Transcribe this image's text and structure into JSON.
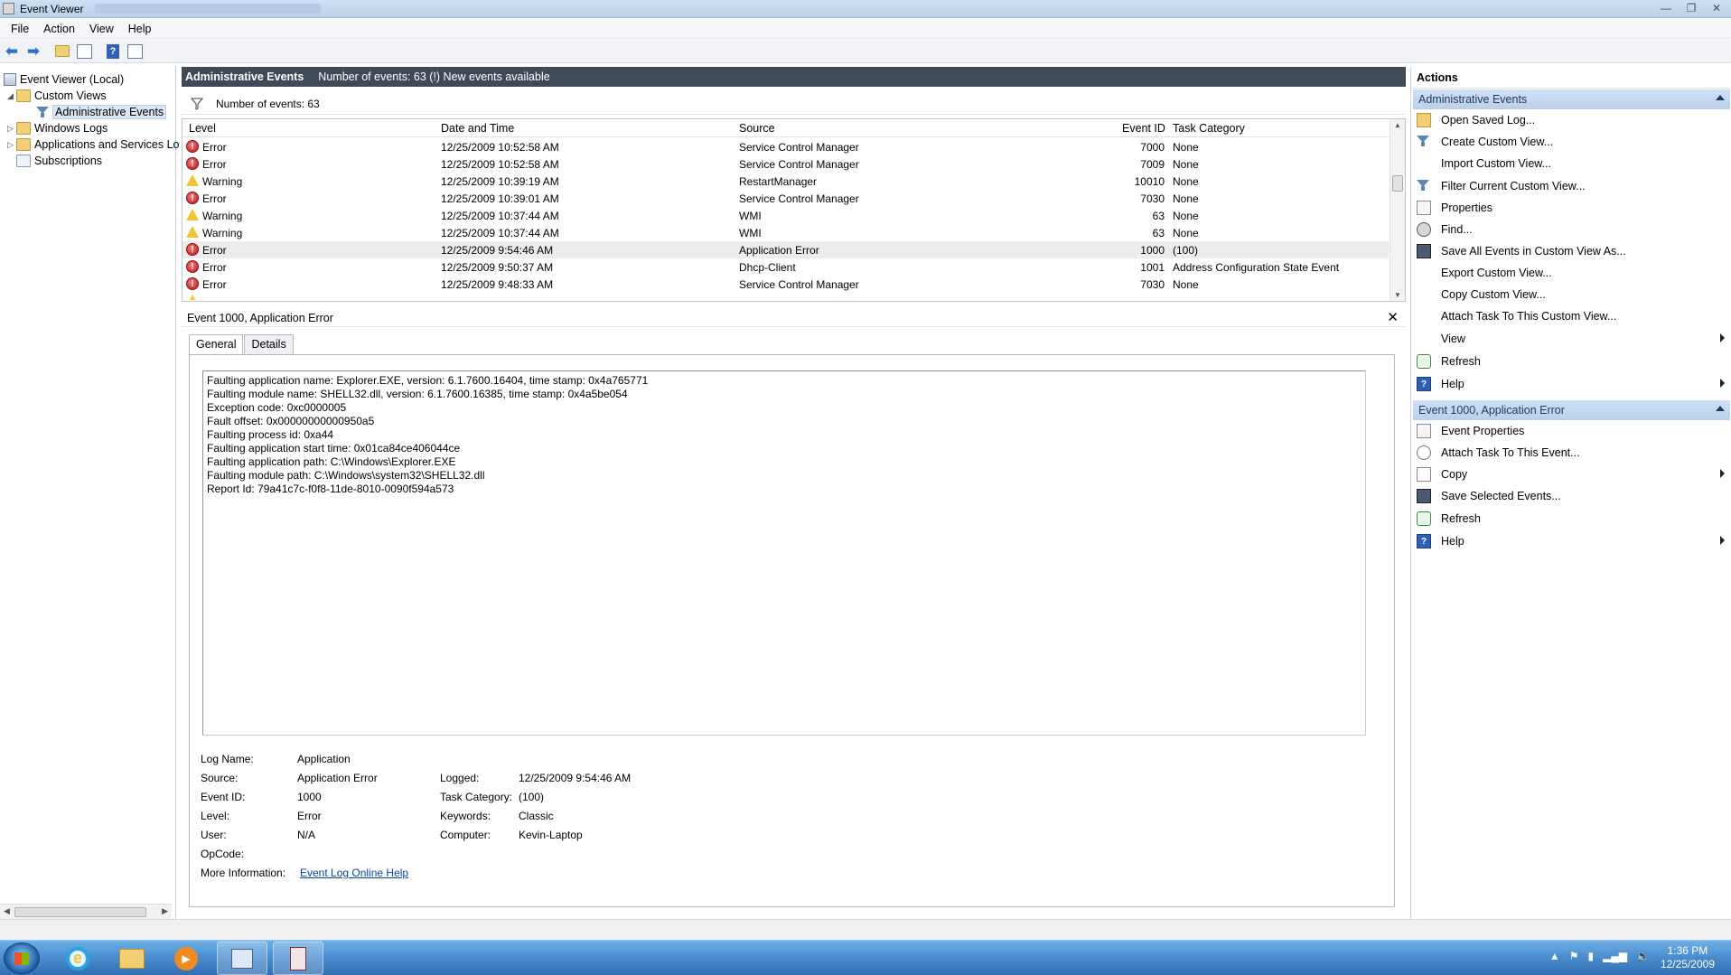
{
  "window": {
    "title": "Event Viewer",
    "controls": [
      "—",
      "❐",
      "✕"
    ]
  },
  "menu": [
    "File",
    "Action",
    "View",
    "Help"
  ],
  "tree": {
    "root": "Event Viewer (Local)",
    "custom_views": "Custom Views",
    "admin_events": "Administrative Events",
    "windows_logs": "Windows Logs",
    "apps_services": "Applications and Services Lo",
    "subscriptions": "Subscriptions"
  },
  "center": {
    "header_title": "Administrative Events",
    "header_info": "Number of events: 63 (!) New events available",
    "filter_text": "Number of events: 63",
    "columns": [
      "Level",
      "Date and Time",
      "Source",
      "Event ID",
      "Task Category"
    ],
    "rows": [
      {
        "level": "Error",
        "datetime": "12/25/2009 10:52:58 AM",
        "source": "Service Control Manager",
        "event_id": "7000",
        "category": "None"
      },
      {
        "level": "Error",
        "datetime": "12/25/2009 10:52:58 AM",
        "source": "Service Control Manager",
        "event_id": "7009",
        "category": "None"
      },
      {
        "level": "Warning",
        "datetime": "12/25/2009 10:39:19 AM",
        "source": "RestartManager",
        "event_id": "10010",
        "category": "None"
      },
      {
        "level": "Error",
        "datetime": "12/25/2009 10:39:01 AM",
        "source": "Service Control Manager",
        "event_id": "7030",
        "category": "None"
      },
      {
        "level": "Warning",
        "datetime": "12/25/2009 10:37:44 AM",
        "source": "WMI",
        "event_id": "63",
        "category": "None"
      },
      {
        "level": "Warning",
        "datetime": "12/25/2009 10:37:44 AM",
        "source": "WMI",
        "event_id": "63",
        "category": "None"
      },
      {
        "level": "Error",
        "datetime": "12/25/2009 9:54:46 AM",
        "source": "Application Error",
        "event_id": "1000",
        "category": "(100)"
      },
      {
        "level": "Error",
        "datetime": "12/25/2009 9:50:37 AM",
        "source": "Dhcp-Client",
        "event_id": "1001",
        "category": "Address Configuration State Event"
      },
      {
        "level": "Error",
        "datetime": "12/25/2009 9:48:33 AM",
        "source": "Service Control Manager",
        "event_id": "7030",
        "category": "None"
      }
    ]
  },
  "detail": {
    "title": "Event 1000, Application Error",
    "tabs": [
      "General",
      "Details"
    ],
    "message_lines": [
      "Faulting application name: Explorer.EXE, version: 6.1.7600.16404, time stamp: 0x4a765771",
      "Faulting module name: SHELL32.dll, version: 6.1.7600.16385, time stamp: 0x4a5be054",
      "Exception code: 0xc0000005",
      "Fault offset: 0x00000000000950a5",
      "Faulting process id: 0xa44",
      "Faulting application start time: 0x01ca84ce406044ce",
      "Faulting application path: C:\\Windows\\Explorer.EXE",
      "Faulting module path: C:\\Windows\\system32\\SHELL32.dll",
      "Report Id: 79a41c7c-f0f8-11de-8010-0090f594a573"
    ],
    "props": {
      "log_name_label": "Log Name:",
      "log_name": "Application",
      "source_label": "Source:",
      "source": "Application Error",
      "logged_label": "Logged:",
      "logged": "12/25/2009 9:54:46 AM",
      "event_id_label": "Event ID:",
      "event_id": "1000",
      "task_category_label": "Task Category:",
      "task_category": "(100)",
      "level_label": "Level:",
      "level": "Error",
      "keywords_label": "Keywords:",
      "keywords": "Classic",
      "user_label": "User:",
      "user": "N/A",
      "computer_label": "Computer:",
      "computer": "Kevin-Laptop",
      "opcode_label": "OpCode:",
      "more_info_label": "More Information:",
      "more_info_link": "Event Log Online Help"
    }
  },
  "actions": {
    "title": "Actions",
    "group1": "Administrative Events",
    "group1_items": [
      {
        "label": "Open Saved Log...",
        "icon": "open-folder-icon"
      },
      {
        "label": "Create Custom View...",
        "icon": "filter-icon"
      },
      {
        "label": "Import Custom View...",
        "icon": ""
      },
      {
        "label": "Filter Current Custom View...",
        "icon": "filter-icon"
      },
      {
        "label": "Properties",
        "icon": "properties-icon"
      },
      {
        "label": "Find...",
        "icon": "find-icon"
      },
      {
        "label": "Save All Events in Custom View As...",
        "icon": "save-icon"
      },
      {
        "label": "Export Custom View...",
        "icon": ""
      },
      {
        "label": "Copy Custom View...",
        "icon": ""
      },
      {
        "label": "Attach Task To This Custom View...",
        "icon": ""
      },
      {
        "label": "View",
        "icon": ""
      },
      {
        "label": "Refresh",
        "icon": "refresh-icon"
      },
      {
        "label": "Help",
        "icon": "help-icon"
      }
    ],
    "group2": "Event 1000, Application Error",
    "group2_items": [
      {
        "label": "Event Properties",
        "icon": "properties-icon"
      },
      {
        "label": "Attach Task To This Event...",
        "icon": "task-icon"
      },
      {
        "label": "Copy",
        "icon": "copy-icon"
      },
      {
        "label": "Save Selected Events...",
        "icon": "save-icon"
      },
      {
        "label": "Refresh",
        "icon": "refresh-icon"
      },
      {
        "label": "Help",
        "icon": "help-icon"
      }
    ]
  },
  "taskbar": {
    "time": "1:36 PM",
    "date": "12/25/2009"
  }
}
